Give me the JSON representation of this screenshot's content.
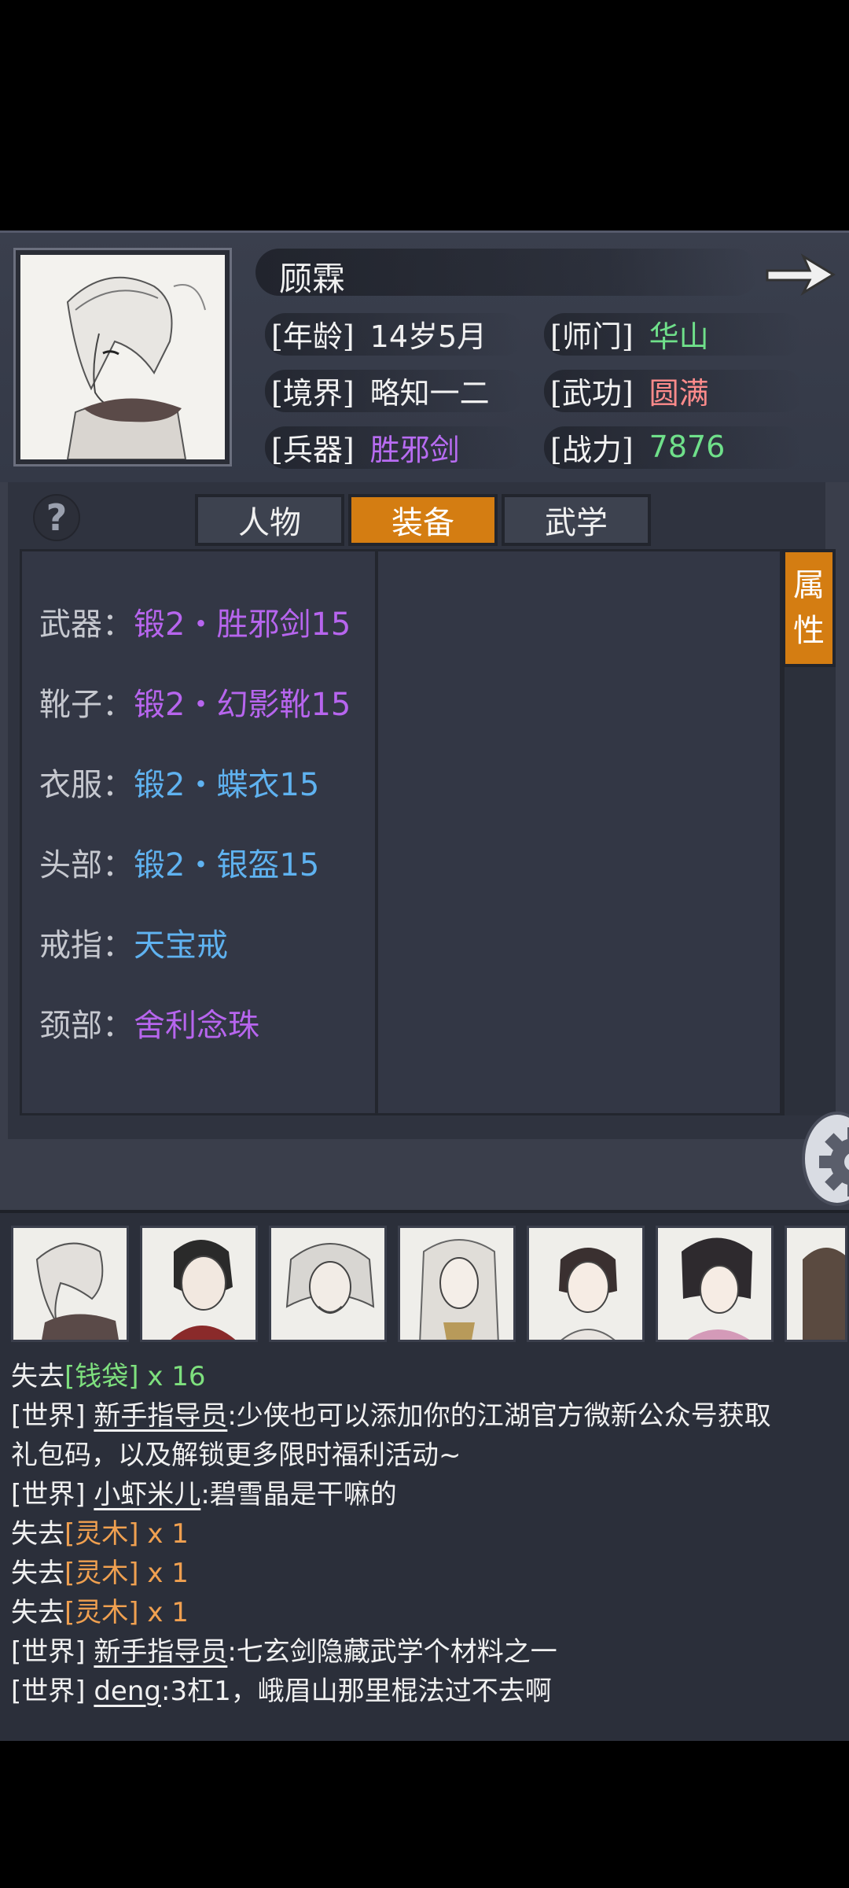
{
  "character": {
    "name": "顾霖",
    "stats": {
      "age": {
        "label": "[年龄]",
        "value": "14岁5月"
      },
      "realm": {
        "label": "[境界]",
        "value": "略知一二"
      },
      "weapon": {
        "label": "[兵器]",
        "value": "胜邪剑"
      },
      "sect": {
        "label": "[师门]",
        "value": "华山"
      },
      "martial": {
        "label": "[武功]",
        "value": "圆满"
      },
      "power": {
        "label": "[战力]",
        "value": "7876"
      }
    }
  },
  "help_icon": "?",
  "tabs": [
    {
      "label": "人物",
      "active": false
    },
    {
      "label": "装备",
      "active": true
    },
    {
      "label": "武学",
      "active": false
    }
  ],
  "side_tab": {
    "line1": "属",
    "line2": "性"
  },
  "equipment": [
    {
      "label": "武器：",
      "item": "锻2・胜邪剑15",
      "quality": "purple"
    },
    {
      "label": "靴子：",
      "item": "锻2・幻影靴15",
      "quality": "purple"
    },
    {
      "label": "衣服：",
      "item": "锻2・蝶衣15",
      "quality": "blue"
    },
    {
      "label": "头部：",
      "item": "锻2・银盔15",
      "quality": "blue"
    },
    {
      "label": "戒指：",
      "item": "天宝戒",
      "quality": "blue"
    },
    {
      "label": "颈部：",
      "item": "舍利念珠",
      "quality": "purple"
    }
  ],
  "colors": {
    "accent_orange": "#d47d12",
    "green": "#6fe08a",
    "purple": "#b765ee",
    "blue": "#5fb2f0",
    "red": "#ff8b8b"
  },
  "icons": [
    "next-arrow-icon",
    "help-icon",
    "settings-gear-icon"
  ],
  "chat": [
    {
      "prefix": "失去",
      "item": "[钱袋]",
      "suffix": " x 16"
    },
    {
      "channel": "[世界]",
      "user": "新手指导员",
      "text": ":少侠也可以添加你的江湖官方微新公众号获取"
    },
    {
      "text": "礼包码，以及解锁更多限时福利活动~"
    },
    {
      "channel": "[世界]",
      "user": "小虾米儿",
      "text": ":碧雪晶是干嘛的"
    },
    {
      "prefix": "失去",
      "item": "[灵木]",
      "suffix": " x 1"
    },
    {
      "prefix": "失去",
      "item": "[灵木]",
      "suffix": " x 1"
    },
    {
      "prefix": "失去",
      "item": "[灵木]",
      "suffix": " x 1"
    },
    {
      "channel": "[世界]",
      "user": "新手指导员",
      "text": ":七玄剑隐藏武学个材料之一"
    },
    {
      "channel": "[世界]",
      "user": "deng",
      "text": ":3杠1，峨眉山那里棍法过不去啊"
    }
  ]
}
